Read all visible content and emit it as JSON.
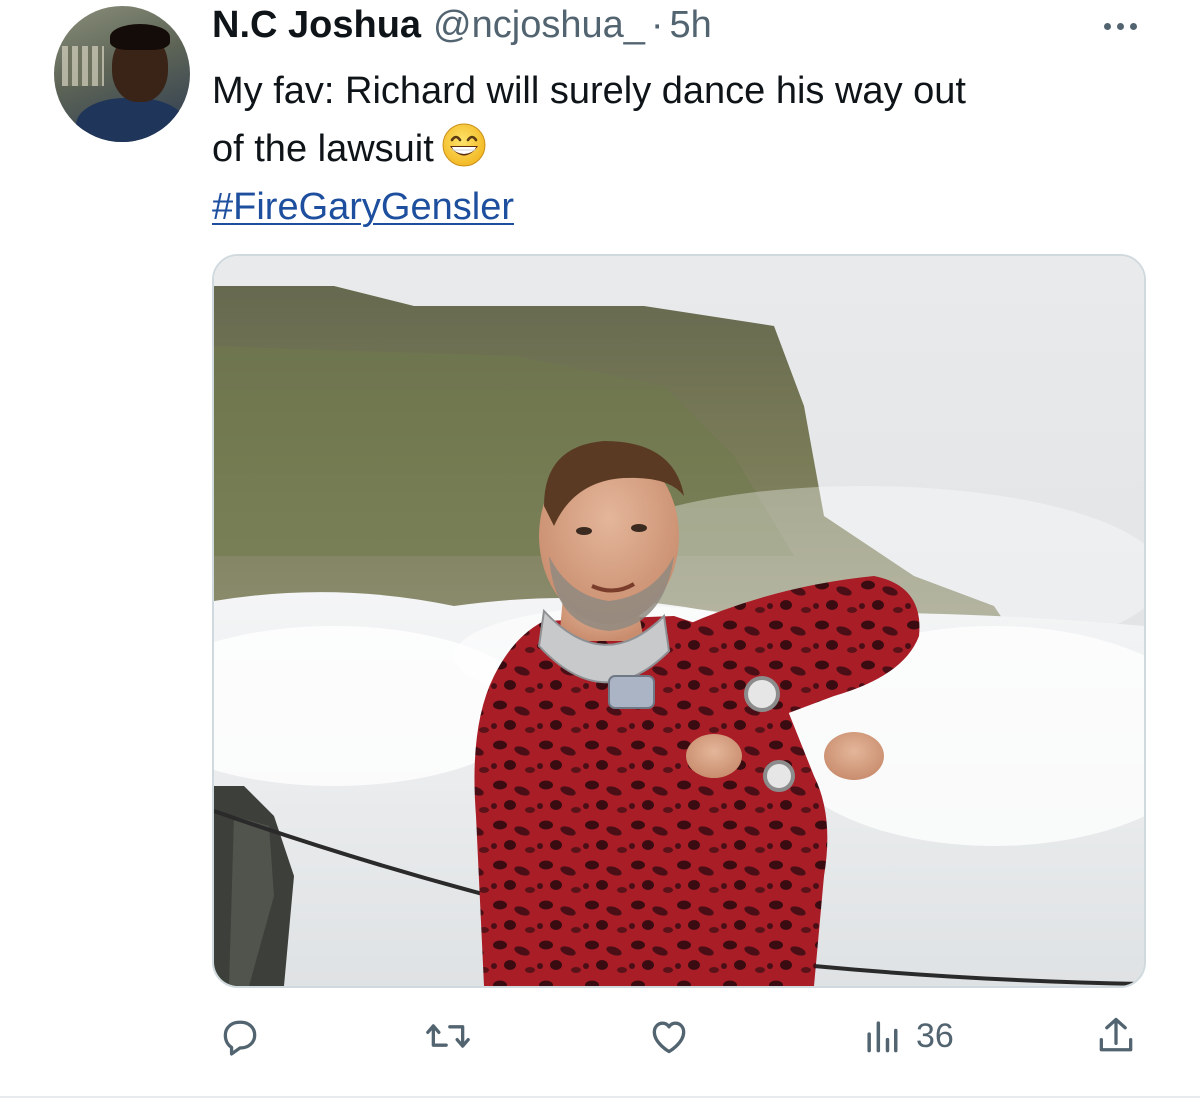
{
  "author": {
    "name": "N.C Joshua",
    "handle": "@ncjoshua_",
    "separator": "·",
    "time": "5h"
  },
  "tweet": {
    "line1": "My fav: Richard will surely dance his way out",
    "line2": "of the lawsuit",
    "emoji": "grinning-face-with-smiling-eyes",
    "hashtag": "#FireGaryGensler"
  },
  "actions": {
    "reply": "",
    "retweet": "",
    "like": "",
    "views": "36",
    "share": ""
  },
  "colors": {
    "text": "#0f1419",
    "muted": "#536471",
    "link": "#1d4f9e",
    "border": "#cfd9de"
  },
  "icons": [
    "more-icon",
    "reply-icon",
    "retweet-icon",
    "like-icon",
    "views-icon",
    "share-icon"
  ]
}
